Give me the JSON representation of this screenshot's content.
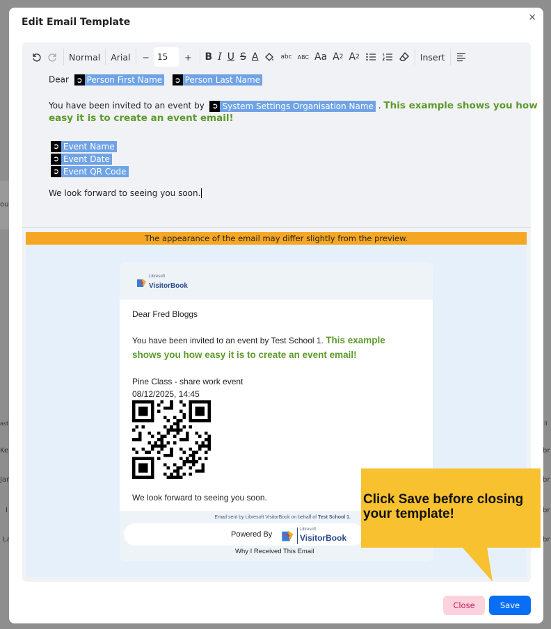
{
  "background": {
    "left_fragments": [
      "ou",
      "ast",
      "Ke",
      "Jan",
      "I",
      "La"
    ],
    "right_fragments": [
      "a",
      "il",
      "br",
      "br",
      "br",
      "br"
    ]
  },
  "modal": {
    "title": "Edit Email Template",
    "close_glyph": "×"
  },
  "toolbar": {
    "paragraph_style": "Normal",
    "font_family": "Arial",
    "decrease_glyph": "−",
    "font_size": "15",
    "increase_glyph": "+",
    "bold": "B",
    "italic": "I",
    "underline": "U",
    "strike": "S",
    "font_color": "A",
    "lowercase": "abc",
    "uppercase": "ABC",
    "font_case": "Aa",
    "subscript_base": "A",
    "subscript_mark": "2",
    "superscript_base": "A",
    "superscript_mark": "2",
    "insert_label": "Insert"
  },
  "compose": {
    "greeting": "Dear",
    "tag_first_name": "Person First Name",
    "tag_last_name": "Person Last Name",
    "invited_text": "You have been invited to an event by",
    "tag_org": "System Settings Organisation Name",
    "after_org": ".",
    "example_line1": "This example shows you how",
    "example_line2": "easy it is to create an event email!",
    "tag_event_name": "Event Name",
    "tag_event_date": "Event Date",
    "tag_event_qr": "Event QR Code",
    "closing": "We look forward to seeing you soon."
  },
  "preview": {
    "warning": "The appearance of the email may differ slightly from the preview.",
    "logo_small": "Libresoft",
    "logo_name": "VisitorBook",
    "greeting": "Dear Fred Bloggs",
    "invited_text": "You have been invited to an event by Test School 1.",
    "example_line1": "This example",
    "example_line2": "shows you how easy it is to create an event email!",
    "event_name": "Pine Class - share work event",
    "event_date": "08/12/2025, 14:45",
    "closing": "We look forward to seeing you soon.",
    "sent_by_prefix": "Email sent by Libresoft VisitorBook on behalf of",
    "sent_by_org": "Test School 1.",
    "powered_by": "Powered By",
    "why_received": "Why I Received This Email"
  },
  "callout": {
    "text": "Click Save before closing your template!"
  },
  "footer": {
    "close_label": "Close",
    "save_label": "Save"
  },
  "colors": {
    "tag_bg": "#6fa3e6",
    "green": "#5c9a2b",
    "warning": "#f5a623",
    "callout": "#f7c12f",
    "save": "#0a6ef5",
    "close_bg": "#fcd3dd",
    "close_text": "#c2185b"
  }
}
